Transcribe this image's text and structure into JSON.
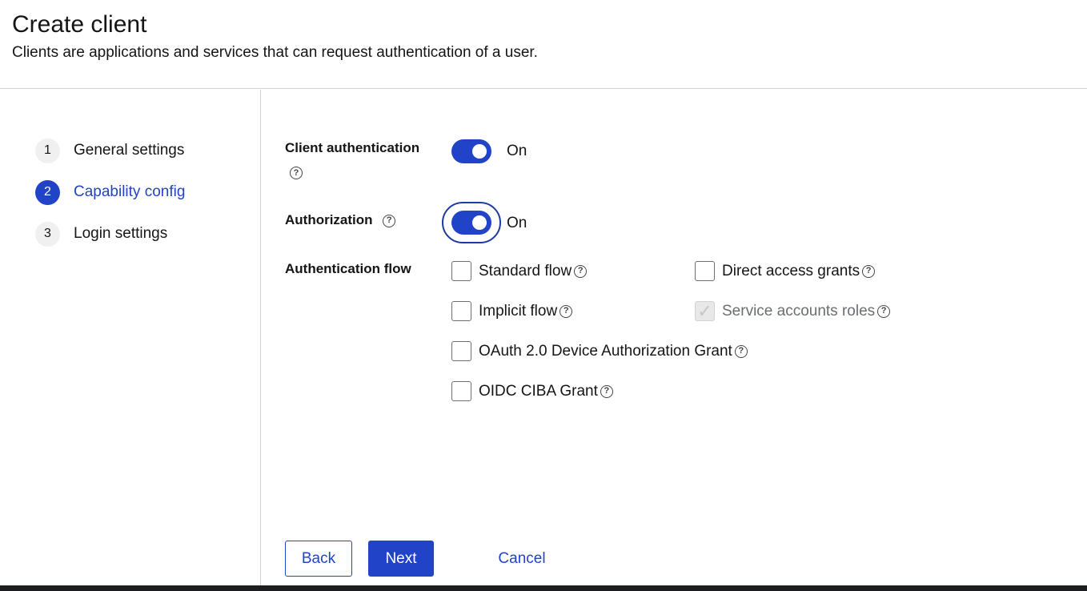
{
  "header": {
    "title": "Create client",
    "subtitle": "Clients are applications and services that can request authentication of a user."
  },
  "wizard": {
    "steps": [
      {
        "number": "1",
        "label": "General settings",
        "active": false
      },
      {
        "number": "2",
        "label": "Capability config",
        "active": true
      },
      {
        "number": "3",
        "label": "Login settings",
        "active": false
      }
    ]
  },
  "form": {
    "client_authentication": {
      "label": "Client authentication",
      "state": "On",
      "enabled": true
    },
    "authorization": {
      "label": "Authorization",
      "state": "On",
      "enabled": true
    },
    "authentication_flow": {
      "label": "Authentication flow",
      "options": {
        "standard_flow": {
          "label": "Standard flow",
          "checked": false
        },
        "direct_access_grants": {
          "label": "Direct access grants",
          "checked": false
        },
        "implicit_flow": {
          "label": "Implicit flow",
          "checked": false
        },
        "service_accounts_roles": {
          "label": "Service accounts roles",
          "checked": true,
          "disabled": true
        },
        "oauth_device_grant": {
          "label": "OAuth 2.0 Device Authorization Grant",
          "checked": false
        },
        "oidc_ciba_grant": {
          "label": "OIDC CIBA Grant",
          "checked": false
        }
      }
    }
  },
  "footer": {
    "back_label": "Back",
    "next_label": "Next",
    "cancel_label": "Cancel"
  },
  "icons": {
    "help": "?",
    "check": "✓"
  },
  "colors": {
    "primary": "#2143c8",
    "text": "#151515",
    "border": "#d2d2d2"
  }
}
